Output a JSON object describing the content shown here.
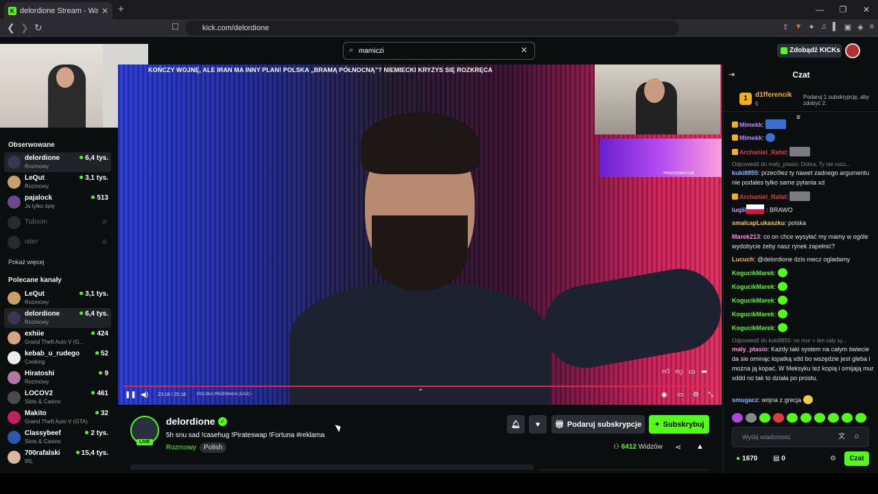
{
  "browser": {
    "tab_title": "delordione Stream - Watch Li",
    "tab_close": "✕",
    "new_tab": "+",
    "url": "kick.com/delordione"
  },
  "header": {
    "search_value": "mamiczi",
    "kicks_button": "Zdobądź KICKs"
  },
  "sidebar": {
    "followed_title": "Obserwowane",
    "followed": [
      {
        "name": "delordione",
        "category": "Rozmowy",
        "viewers": "6,4 tys.",
        "active": true
      },
      {
        "name": "LeQut",
        "category": "Rozmowy",
        "viewers": "3,1 tys."
      },
      {
        "name": "pajalock",
        "category": "Ja tylko śpię",
        "viewers": "513"
      },
      {
        "name": "Tubson",
        "offline": true
      },
      {
        "name": "niter",
        "offline": true
      }
    ],
    "show_more": "Pokaż więcej",
    "recommended_title": "Polecane kanały",
    "recommended": [
      {
        "name": "LeQut",
        "category": "Rozmowy",
        "viewers": "3,1 tys."
      },
      {
        "name": "delordione",
        "category": "Rozmowy",
        "viewers": "6,4 tys.",
        "active": true
      },
      {
        "name": "exhiie",
        "category": "Grand Theft Auto V (G...",
        "viewers": "424"
      },
      {
        "name": "kebab_u_rudego",
        "category": "Cooking",
        "viewers": "52"
      },
      {
        "name": "Hiratoshi",
        "category": "Rozmowy",
        "viewers": "9"
      },
      {
        "name": "LOCOV2",
        "category": "Slots & Casino",
        "viewers": "461"
      },
      {
        "name": "Makito",
        "category": "Grand Theft Auto V (GTA)",
        "viewers": "32"
      },
      {
        "name": "Classybeef",
        "category": "Slots & Casino",
        "viewers": "2 tys."
      },
      {
        "name": "700rafalski",
        "category": "IRL",
        "viewers": "15,4 tys."
      }
    ]
  },
  "player": {
    "headline": "KOŃCZY WOJNĘ, ALE IRAN MA INNY PLAN! POLSKA „BRAMĄ PÓŁNOCNĄ”? NIEMIECKI KRYZYS SIĘ ROZKRĘCA",
    "time": "23:18 / 25:18",
    "chapter": "POLSKA PRZEWAGA (GAZ) ›",
    "ad_text": "PIRATESWAP.COM"
  },
  "stream": {
    "name": "delordione",
    "title": "5h snu sad !casehug !Pirateswap !Fortuna #reklama",
    "category": "Rozmowy",
    "tag": "Polish",
    "live": "LIVE",
    "viewers_count": "6412",
    "viewers_label": "Widzów",
    "gift_button": "Podaruj subskrypcje",
    "subscribe_button": "Subskrybuj"
  },
  "chat": {
    "title": "Czat",
    "gifter_rank": "1",
    "gifter_name": "d1fferencik",
    "gifter_count": "5",
    "gift_prompt": "Podaruj 1 subskrypcję, aby zdobyć 2.",
    "messages": [
      {
        "user": "Mimekk",
        "color": "#b08cff",
        "text": ":"
      },
      {
        "user": "Mimekk",
        "color": "#b08cff",
        "text": ":"
      },
      {
        "user": "Archaniel_Rafal",
        "color": "#e23b3b",
        "text": ":"
      },
      {
        "reply": "Odpowiedź do maly_ptasio: Dobra, Ty nie rozu..."
      },
      {
        "user": "kuki8855",
        "color": "#8ab4ff",
        "text": ": przeci9ez ty nawet zadnego argumentu nie podales tylko same pytania xd"
      },
      {
        "user": "Archaniel_Rafal",
        "color": "#e23b3b",
        "text": ":"
      },
      {
        "user": "luqiii",
        "color": "#c39bff",
        "text": ": BRAWO"
      },
      {
        "user": "smalcapLukaszku",
        "color": "#f2c94c",
        "text": ": polska"
      },
      {
        "user": "Marek213",
        "color": "#ff8ad8",
        "text": ": co on chce wysyłać my mamy w ogóle wydobycie żeby nasz rynek zapełnić?"
      },
      {
        "user": "Lucuch",
        "color": "#ffb35c",
        "text": ": @delordione dzis mecz ogladamy"
      },
      {
        "user": "KogucikMarek",
        "color": "#53fc18",
        "text": ":"
      },
      {
        "user": "KogucikMarek",
        "color": "#53fc18",
        "text": ":"
      },
      {
        "user": "KogucikMarek",
        "color": "#53fc18",
        "text": ":"
      },
      {
        "user": "KogucikMarek",
        "color": "#53fc18",
        "text": ":"
      },
      {
        "user": "KogucikMarek",
        "color": "#53fc18",
        "text": ":"
      },
      {
        "reply": "Odpowiedź do kuki8855: no mur = ten caly sy..."
      },
      {
        "user": "maly_ptasio",
        "color": "#ff8ad8",
        "text": ": Każdy taki system na całym świecie da sie ominąc łopatką xdd bo wszędzie jest gleba i można ją kopać. W Meksyku też kopią i omijają mur xddd no tak to działa po prostu."
      },
      {
        "user": "smugacz",
        "color": "#8ab4ff",
        "text": ": wojna z grecja"
      }
    ],
    "input_placeholder": "Wyślij wiadomość",
    "points": "1670",
    "drops": "0",
    "send_button": "Czat"
  }
}
